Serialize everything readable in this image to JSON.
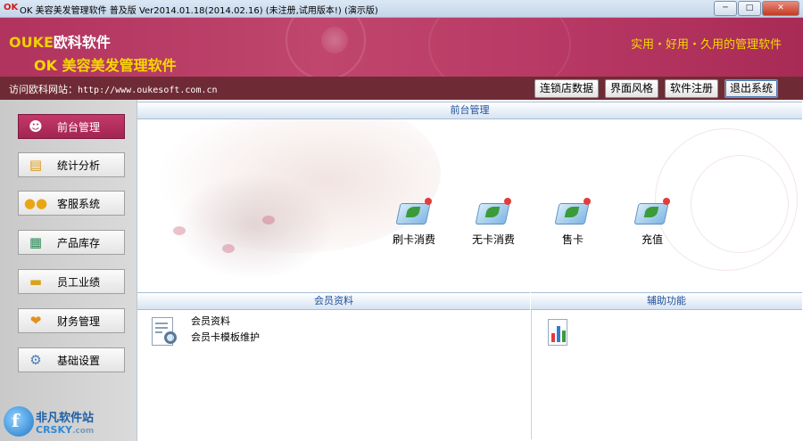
{
  "window": {
    "app_icon": "OK",
    "title": "OK 美容美发管理软件 普及版 Ver2014.01.18(2014.02.16) (未注册,试用版本!) (演示版)",
    "buttons": [
      "minimize-icon",
      "maximize-icon",
      "close-icon"
    ]
  },
  "banner": {
    "brand_en": "OUKE",
    "brand_cn": "欧科软件",
    "product": "OK 美容美发管理软件",
    "slogan": "实用・好用・久用的管理软件"
  },
  "nav": {
    "site_label": "访问欧科网站：",
    "site_url": "http://www.oukesoft.com.cn",
    "buttons": [
      "连锁店数据",
      "界面风格",
      "软件注册",
      "退出系统"
    ]
  },
  "sidebar": {
    "items": [
      {
        "label": "前台管理",
        "icon": "person-icon",
        "active": true
      },
      {
        "label": "统计分析",
        "icon": "chart-icon",
        "active": false
      },
      {
        "label": "客服系统",
        "icon": "people-icon",
        "active": false
      },
      {
        "label": "产品库存",
        "icon": "box-icon",
        "active": false
      },
      {
        "label": "员工业绩",
        "icon": "money-icon",
        "active": false
      },
      {
        "label": "财务管理",
        "icon": "heart-icon",
        "active": false
      },
      {
        "label": "基础设置",
        "icon": "settings-icon",
        "active": false
      }
    ]
  },
  "main": {
    "front_title": "前台管理",
    "features": [
      {
        "label": "刷卡消费",
        "icon": "card-icon"
      },
      {
        "label": "无卡消费",
        "icon": "card-icon"
      },
      {
        "label": "售卡",
        "icon": "card-icon"
      },
      {
        "label": "充值",
        "icon": "card-icon"
      }
    ],
    "member_title": "会员资料",
    "member_links": [
      "会员资料",
      "会员卡模板维护"
    ],
    "aux_title": "辅助功能"
  },
  "watermark": {
    "name": "非凡软件站",
    "site": "CRSKY",
    "suffix": ".com"
  },
  "colors": {
    "banner": "#b73864",
    "nav_strip": "#6f2b35",
    "slogan": "#f6d800",
    "section_title": "#1e4f9c"
  }
}
